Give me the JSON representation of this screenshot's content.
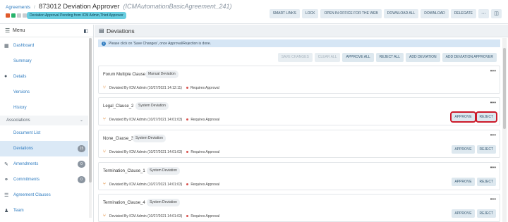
{
  "header": {
    "breadcrumb": "Agreements",
    "title": "873012 Deviation Approver",
    "subtitle": "(ICMAutomationBasicAgreement_241)",
    "status": "Deviation Approval Pending from ICM Admin,Third Approver",
    "dot_colors": [
      "#e05a2b",
      "#26b36b",
      "#c8ccd0",
      "#c8ccd0"
    ],
    "toolbar": {
      "smart_links": "SMART LINKS",
      "lock": "LOCK",
      "open_office": "OPEN IN OFFICE FOR THE WEB",
      "download_all": "DOWNLOAD ALL",
      "download": "DOWNLOAD",
      "delegate": "DELEGATE",
      "more": "···",
      "panel": "◫"
    }
  },
  "sidebar": {
    "menu_label": "Menu",
    "items": [
      {
        "label": "Dashboard",
        "icon": "dashboard-icon"
      },
      {
        "label": "Summary"
      },
      {
        "label": "Details",
        "icon": "info-icon"
      },
      {
        "label": "Versions"
      },
      {
        "label": "History"
      },
      {
        "label": "Associations",
        "group": true
      },
      {
        "label": "Document List"
      },
      {
        "label": "Deviations",
        "count": "15",
        "active": true
      },
      {
        "label": "Amendments",
        "icon": "edit-icon",
        "count": "0"
      },
      {
        "label": "Commitments",
        "icon": "link-icon",
        "count": "0"
      },
      {
        "label": "Agreement Clauses",
        "icon": "list-icon"
      },
      {
        "label": "Team",
        "icon": "team-icon"
      }
    ]
  },
  "main": {
    "title": "Deviations",
    "info": "Please click on 'Save Changes', once Approval/Rejection is done.",
    "actions": {
      "save_changes": "SAVE CHANGES",
      "clear_all": "CLEAR ALL",
      "approve_all": "APPROVE ALL",
      "reject_all": "REJECT ALL",
      "add_deviation": "ADD DEVIATION",
      "add_deviation_approver": "ADD DEVIATION APPROVER"
    },
    "cards": [
      {
        "clause": "Forum Multiple Clause",
        "type": "Manual Deviation",
        "meta": "Deviated By ICM Admin (10/27/2021 14:12:11)",
        "status": "Requires Approval",
        "more": "•••"
      },
      {
        "clause": "Legal_Clause_2",
        "type": "System Deviation",
        "meta": "Deviated By ICM Admin (10/27/2021 14:01:03)",
        "status": "Requires Approval",
        "more": "•••",
        "approve": "APPROVE",
        "reject": "REJECT"
      },
      {
        "clause": "None_Clause_3",
        "type": "System Deviation",
        "meta": "Deviated By ICM Admin (10/27/2021 14:01:03)",
        "status": "Requires Approval",
        "more": "•••",
        "approve": "APPROVE",
        "reject": "REJECT"
      },
      {
        "clause": "Termination_Clause_1",
        "type": "System Deviation",
        "meta": "Deviated By ICM Admin (10/27/2021 14:01:03)",
        "status": "Requires Approval",
        "more": "•••",
        "approve": "APPROVE",
        "reject": "REJECT"
      },
      {
        "clause": "Termination_Clause_4",
        "type": "System Deviation",
        "meta": "Deviated By ICM Admin (10/27/2021 14:01:03)",
        "status": "Requires Approval",
        "more": "•••",
        "approve": "APPROVE",
        "reject": "REJECT"
      }
    ]
  }
}
